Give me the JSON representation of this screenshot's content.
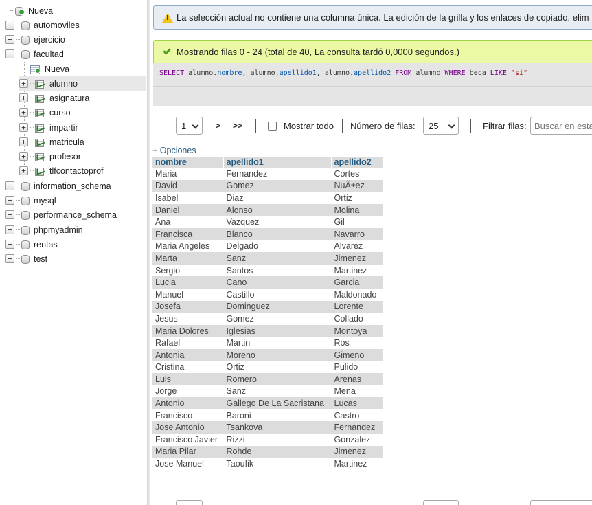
{
  "sidebar": {
    "new_label": "Nueva",
    "databases": [
      {
        "name": "automoviles"
      },
      {
        "name": "ejercicio"
      },
      {
        "name": "facultad"
      }
    ],
    "facultad_children": {
      "new_label": "Nueva",
      "tables": [
        "alumno",
        "asignatura",
        "curso",
        "impartir",
        "matricula",
        "profesor",
        "tlfcontactoprof"
      ],
      "selected": "alumno"
    },
    "other_databases": [
      "information_schema",
      "mysql",
      "performance_schema",
      "phpmyadmin",
      "rentas",
      "test"
    ]
  },
  "notice": {
    "text": "La selección actual no contiene una columna única. La edición de la grilla y los enlaces de copiado, elim"
  },
  "success": {
    "text": "Mostrando filas 0 - 24 (total de 40, La consulta tardó 0,0000 segundos.)"
  },
  "sql": {
    "select": "SELECT",
    "f1_table": "alumno",
    "f1_field": "nombre",
    "f2_table": "alumno",
    "f2_field": "apellido1",
    "f3_table": "alumno",
    "f3_field": "apellido2",
    "from": "FROM",
    "table": "alumno",
    "where": "WHERE",
    "column": "beca",
    "like": "LIKE",
    "value": "\"si\""
  },
  "nav": {
    "page_value": "1",
    "next": ">",
    "last": ">>",
    "show_all_label": "Mostrar todo",
    "rows_label": "Número de filas:",
    "rows_value": "25",
    "filter_label": "Filtrar filas:",
    "filter_placeholder": "Buscar en esta"
  },
  "options_link": "+ Opciones",
  "table": {
    "headers": [
      "nombre",
      "apellido1",
      "apellido2"
    ],
    "rows": [
      [
        "Maria",
        "Fernandez",
        "Cortes"
      ],
      [
        "David",
        "Gomez",
        "NuÃ±ez"
      ],
      [
        "Isabel",
        "Diaz",
        "Ortiz"
      ],
      [
        "Daniel",
        "Alonso",
        "Molina"
      ],
      [
        "Ana",
        "Vazquez",
        "Gil"
      ],
      [
        "Francisca",
        "Blanco",
        "Navarro"
      ],
      [
        "Maria Angeles",
        "Delgado",
        "Alvarez"
      ],
      [
        "Marta",
        "Sanz",
        "Jimenez"
      ],
      [
        "Sergio",
        "Santos",
        "Martinez"
      ],
      [
        "Lucia",
        "Cano",
        "Garcia"
      ],
      [
        "Manuel",
        "Castillo",
        "Maldonado"
      ],
      [
        "Josefa",
        "Dominguez",
        "Lorente"
      ],
      [
        "Jesus",
        "Gomez",
        "Collado"
      ],
      [
        "Maria Dolores",
        "Iglesias",
        "Montoya"
      ],
      [
        "Rafael",
        "Martin",
        "Ros"
      ],
      [
        "Antonia",
        "Moreno",
        "Gimeno"
      ],
      [
        "Cristina",
        "Ortiz",
        "Pulido"
      ],
      [
        "Luis",
        "Romero",
        "Arenas"
      ],
      [
        "Jorge",
        "Sanz",
        "Mena"
      ],
      [
        "Antonio",
        "Gallego De La Sacristana",
        "Lucas"
      ],
      [
        "Francisco",
        "Baroni",
        "Castro"
      ],
      [
        "Jose Antonio",
        "Tsankova",
        "Fernandez"
      ],
      [
        "Francisco Javier",
        "Rizzi",
        "Gonzalez"
      ],
      [
        "Maria Pilar",
        "Rohde",
        "Jimenez"
      ],
      [
        "Jose Manuel",
        "Taoufik",
        "Martinez"
      ]
    ]
  },
  "colors": {
    "notice_bg": "#e8edf4",
    "success_bg": "#ebf8a4",
    "header_text": "#235a81",
    "zebra": "#dcdcdc"
  }
}
